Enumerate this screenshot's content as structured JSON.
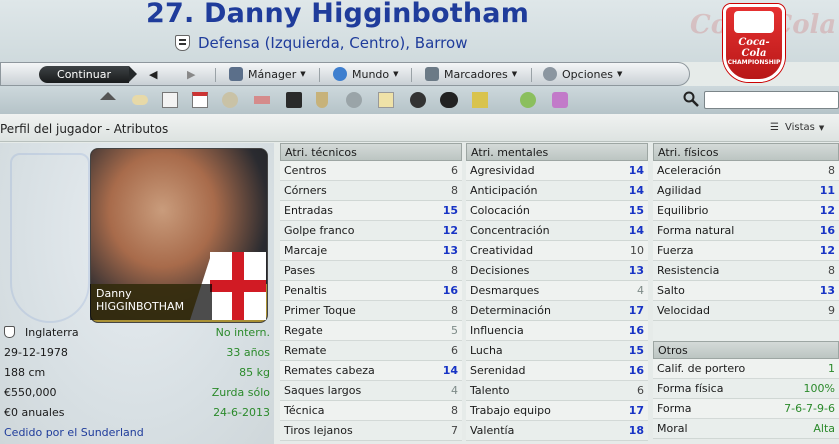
{
  "header": {
    "title": "27. Danny Higginbotham",
    "subtitle": "Defensa (Izquierda, Centro), Barrow"
  },
  "toolbar": {
    "continue": "Continuar",
    "manager": "Mánager",
    "world": "Mundo",
    "scores": "Marcadores",
    "options": "Opciones"
  },
  "crumb": "Perfil del jugador - Atributos",
  "views_label": "Vistas",
  "player": {
    "first_name": "Danny",
    "last_name": "HIGGINBOTHAM",
    "nationality": "Inglaterra",
    "international": "No intern.",
    "birth_date": "29-12-1978",
    "age": "33 años",
    "height": "188 cm",
    "weight": "85 kg",
    "value": "€550,000",
    "foot": "Zurda sólo",
    "wage": "€0 anuales",
    "contract_end": "24-6-2013",
    "loan": "Cedido por el Sunderland"
  },
  "technical": {
    "title": "Atri. técnicos",
    "items": [
      {
        "name": "Centros",
        "value": "6"
      },
      {
        "name": "Córners",
        "value": "8"
      },
      {
        "name": "Entradas",
        "value": "15"
      },
      {
        "name": "Golpe franco",
        "value": "12"
      },
      {
        "name": "Marcaje",
        "value": "13"
      },
      {
        "name": "Pases",
        "value": "8"
      },
      {
        "name": "Penaltis",
        "value": "16"
      },
      {
        "name": "Primer Toque",
        "value": "8"
      },
      {
        "name": "Regate",
        "value": "5"
      },
      {
        "name": "Remate",
        "value": "6"
      },
      {
        "name": "Remates cabeza",
        "value": "14"
      },
      {
        "name": "Saques largos",
        "value": "4"
      },
      {
        "name": "Técnica",
        "value": "8"
      },
      {
        "name": "Tiros lejanos",
        "value": "7"
      }
    ]
  },
  "mental": {
    "title": "Atri. mentales",
    "items": [
      {
        "name": "Agresividad",
        "value": "14"
      },
      {
        "name": "Anticipación",
        "value": "14"
      },
      {
        "name": "Colocación",
        "value": "15"
      },
      {
        "name": "Concentración",
        "value": "14"
      },
      {
        "name": "Creatividad",
        "value": "10"
      },
      {
        "name": "Decisiones",
        "value": "13"
      },
      {
        "name": "Desmarques",
        "value": "4"
      },
      {
        "name": "Determinación",
        "value": "17"
      },
      {
        "name": "Influencia",
        "value": "16"
      },
      {
        "name": "Lucha",
        "value": "15"
      },
      {
        "name": "Serenidad",
        "value": "16"
      },
      {
        "name": "Talento",
        "value": "6"
      },
      {
        "name": "Trabajo equipo",
        "value": "17"
      },
      {
        "name": "Valentía",
        "value": "18"
      }
    ]
  },
  "physical": {
    "title": "Atri. físicos",
    "items": [
      {
        "name": "Aceleración",
        "value": "8"
      },
      {
        "name": "Agilidad",
        "value": "11"
      },
      {
        "name": "Equilibrio",
        "value": "12"
      },
      {
        "name": "Forma natural",
        "value": "16"
      },
      {
        "name": "Fuerza",
        "value": "12"
      },
      {
        "name": "Resistencia",
        "value": "8"
      },
      {
        "name": "Salto",
        "value": "13"
      },
      {
        "name": "Velocidad",
        "value": "9"
      }
    ]
  },
  "others": {
    "title": "Otros",
    "items": [
      {
        "name": "Calif. de portero",
        "value": "1"
      },
      {
        "name": "Forma física",
        "value": "100%"
      },
      {
        "name": "Forma",
        "value": "7-6-7-9-6"
      },
      {
        "name": "Moral",
        "value": "Alta"
      }
    ]
  },
  "colors": {
    "title_blue": "#1f3c9b",
    "attr_high": "#1733c5",
    "attr_green": "#2b8a2b"
  }
}
